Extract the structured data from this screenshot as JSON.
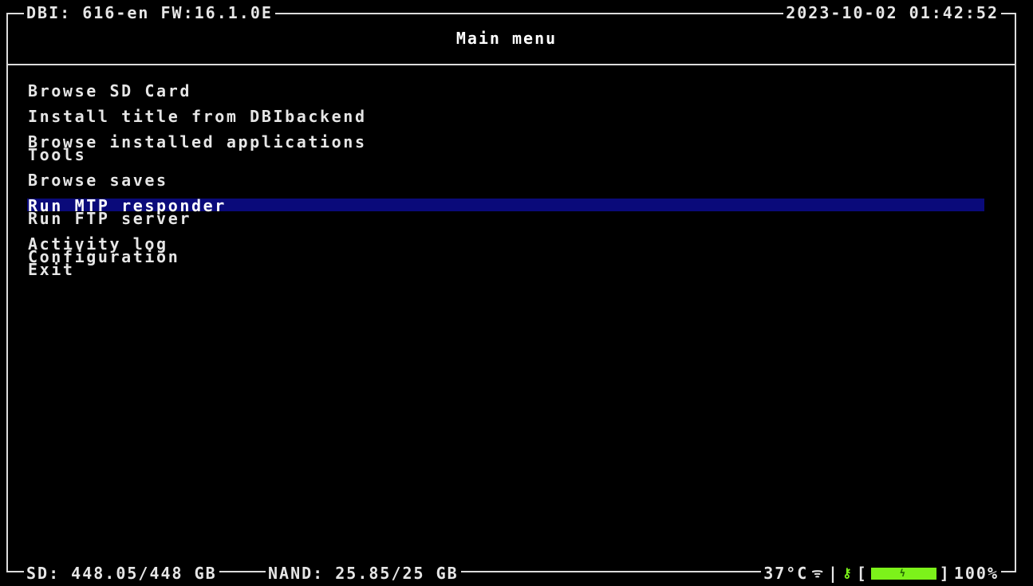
{
  "header": {
    "app_info": "DBI: 616-en FW:16.1.0E",
    "datetime": "2023-10-02 01:42:52",
    "title": "Main menu"
  },
  "menu": {
    "items": [
      "Browse SD Card",
      "Install title from DBIbackend",
      "Browse installed applications",
      "Tools",
      "Browse saves",
      "Run MTP responder",
      "Run FTP server",
      "Activity log",
      "Configuration",
      "Exit"
    ],
    "selected": "Run MTP responder"
  },
  "footer": {
    "sd": "SD: 448.05/448 GB",
    "nand": "NAND: 25.85/25 GB",
    "temp": "37°C",
    "wifi_icon": "wifi-icon",
    "signal": "|",
    "key_icon": "key-icon",
    "battery_open": "[",
    "battery_glyph": "ϟ",
    "battery_close": "]",
    "battery_percent": "100%",
    "battery_level": 1.0,
    "colors": {
      "battery": "#7cf21a",
      "highlight": "#0a0a7a"
    }
  }
}
